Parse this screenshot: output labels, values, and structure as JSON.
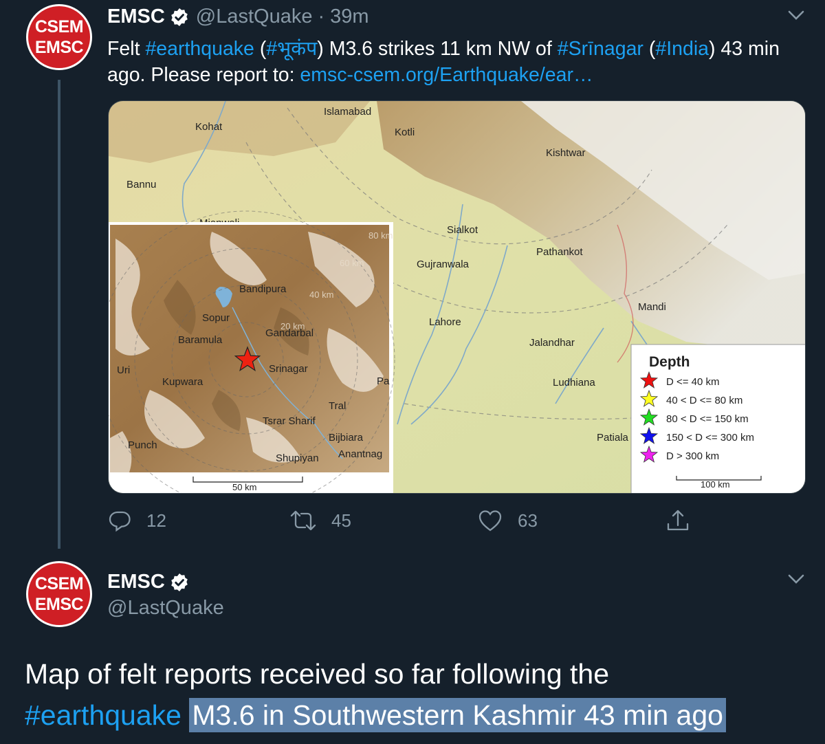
{
  "tweet1": {
    "avatar": {
      "line1": "CSEM",
      "line2": "EMSC"
    },
    "name": "EMSC",
    "handle": "@LastQuake",
    "separator": "·",
    "time": "39m",
    "text": {
      "p1": "Felt ",
      "tag_earthquake": "#earthquake",
      "p2": " (",
      "tag_hindi": "#भूकंप",
      "p3": ") M3.6 strikes 11 km NW of ",
      "tag_srinagar": "#Srīnagar",
      "p4": " (",
      "tag_india": "#India",
      "p5": ") 43 min ago. Please report to: ",
      "link": "emsc-csem.org/Earthquake/ear…"
    },
    "map": {
      "places": [
        "Islamabad",
        "Kohat",
        "Kotli",
        "Kishtwar",
        "Bannu",
        "Mianwali",
        "Sialkot",
        "Gujranwala",
        "Pathankot",
        "Lahore",
        "Mandi",
        "Jalandhar",
        "Ludhiana",
        "Patiala"
      ],
      "inset_places": [
        "Bandipura",
        "Sopur",
        "Gandarbal",
        "Baramula",
        "Srinagar",
        "Uri",
        "Kupwara",
        "Tral",
        "Tsrar Sharif",
        "Bijbiara",
        "Punch",
        "Shupiyan",
        "Anantnag",
        "Pa"
      ],
      "inset_rings": [
        "80 km",
        "60 km",
        "40 km",
        "20 km"
      ],
      "inset_scale": "50 km",
      "legend_title": "Depth",
      "legend_items": [
        {
          "label": "D <= 40 km",
          "color": "#ee1111"
        },
        {
          "label": "40 < D <= 80 km",
          "color": "#ffff22"
        },
        {
          "label": "80 < D <= 150 km",
          "color": "#22dd22"
        },
        {
          "label": "150 < D <= 300 km",
          "color": "#1111ee"
        },
        {
          "label": "D > 300 km",
          "color": "#ee22ee"
        }
      ],
      "legend_scale": "100 km"
    },
    "actions": {
      "reply_count": "12",
      "retweet_count": "45",
      "like_count": "63"
    }
  },
  "tweet2": {
    "avatar": {
      "line1": "CSEM",
      "line2": "EMSC"
    },
    "name": "EMSC",
    "handle": "@LastQuake",
    "text": {
      "p1": "Map of felt reports received so far following the",
      "tag": "#earthquake",
      "highlight": "M3.6 in Southwestern Kashmir 43 min ago"
    }
  },
  "colors": {
    "background": "#15202b",
    "link": "#1da1f2",
    "muted": "#8899a6",
    "avatar_red": "#cf1f25",
    "highlight": "#5c80a8"
  }
}
